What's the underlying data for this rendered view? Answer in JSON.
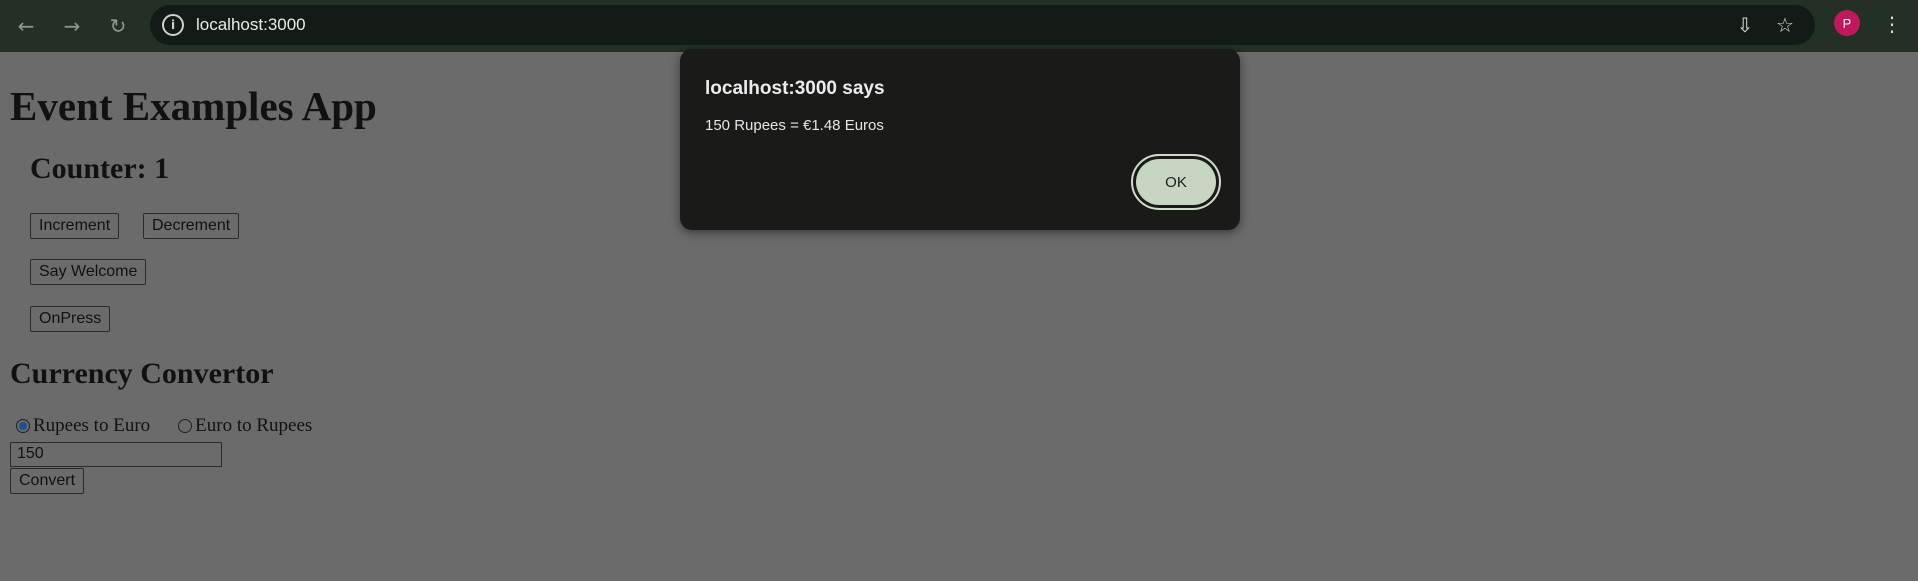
{
  "browser": {
    "url": "localhost:3000",
    "profile_initial": "P",
    "icons": {
      "back": "←",
      "forward": "→",
      "reload": "↻",
      "info": "i",
      "install": "⇩",
      "bookmark": "☆",
      "menu": "⋮"
    }
  },
  "page": {
    "title": "Event Examples App",
    "counter_text": "Counter: 1",
    "buttons": {
      "increment": "Increment",
      "decrement": "Decrement",
      "say_welcome": "Say Welcome",
      "onpress": "OnPress",
      "convert": "Convert"
    },
    "currency": {
      "heading": "Currency Convertor",
      "option_1": "Rupees to Euro",
      "option_2": "Euro to Rupees",
      "selected": "Rupees to Euro",
      "amount_value": "150"
    }
  },
  "dialog": {
    "title": "localhost:3000 says",
    "message": "150 Rupees = €1.48 Euros",
    "ok_label": "OK"
  },
  "colors": {
    "page_bg_dimmed": "#6b6b6b",
    "chrome_bg": "#223026",
    "dialog_bg": "#1a1b18",
    "ok_button": "#c6d6c3",
    "avatar": "#c2185b"
  }
}
